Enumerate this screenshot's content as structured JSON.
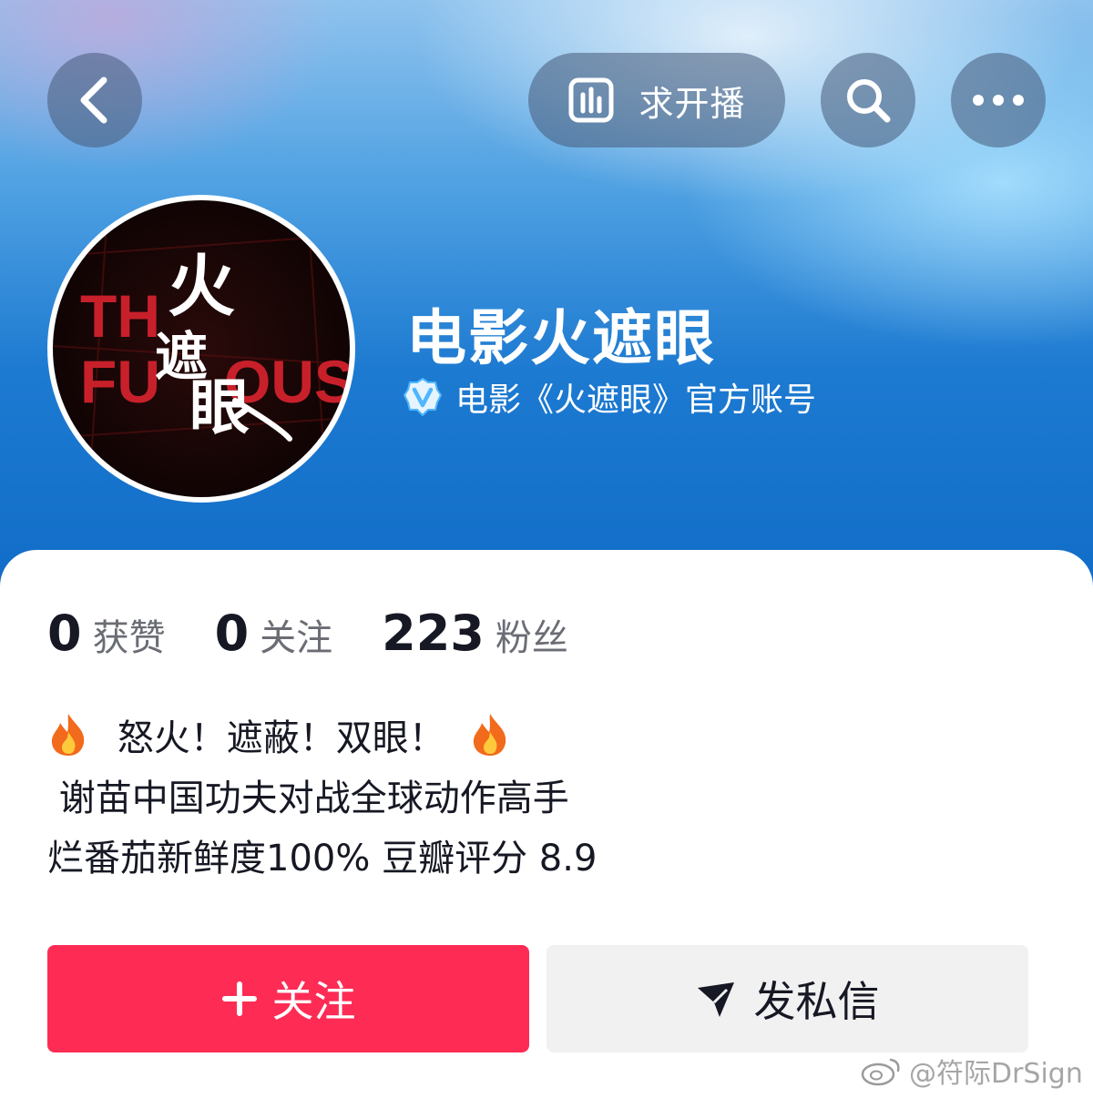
{
  "header": {
    "live_request_label": "求开播",
    "icons": [
      "back-icon",
      "live-bars-icon",
      "search-icon",
      "more-icon"
    ]
  },
  "profile": {
    "avatar_text": {
      "en_line1": "TH",
      "en_line2": "FU",
      "en_line2_end": "OUS",
      "cn_chars": [
        "火",
        "遮",
        "眼"
      ]
    },
    "name": "电影火遮眼",
    "verify_text": "电影《火遮眼》官方账号",
    "verify_color": "#4fb6ff"
  },
  "stats": [
    {
      "value": "0",
      "label": "获赞"
    },
    {
      "value": "0",
      "label": "关注"
    },
    {
      "value": "223",
      "label": "粉丝"
    }
  ],
  "bio": {
    "line1": "怒火！遮蔽！双眼！",
    "line2": " 谢苗中国功夫对战全球动作高手",
    "line3": "烂番茄新鲜度100% 豆瓣评分 8.9"
  },
  "actions": {
    "follow_label": "关注",
    "message_label": "发私信",
    "follow_color": "#fe2c55"
  },
  "watermark": "@符际DrSign"
}
